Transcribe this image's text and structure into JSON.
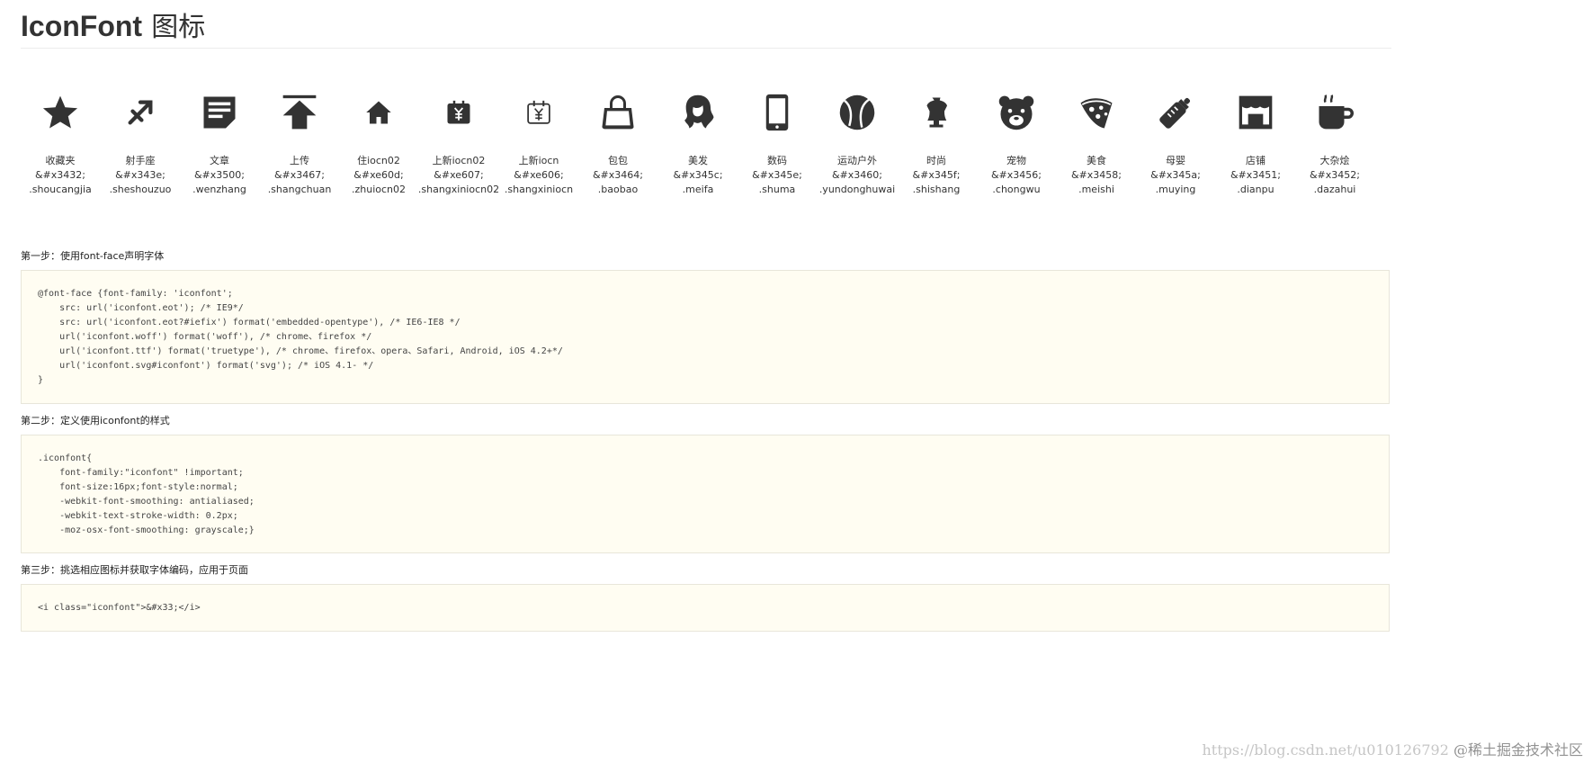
{
  "header": {
    "title_en": "IconFont",
    "title_zh": "图标"
  },
  "icons": [
    {
      "icon": "star-icon",
      "name": "收藏夹",
      "code": "&#x3432;",
      "cls": ".shoucangjia"
    },
    {
      "icon": "sagittarius-icon",
      "name": "射手座",
      "code": "&#x343e;",
      "cls": ".sheshouzuo"
    },
    {
      "icon": "article-icon",
      "name": "文章",
      "code": "&#x3500;",
      "cls": ".wenzhang"
    },
    {
      "icon": "upload-icon",
      "name": "上传",
      "code": "&#x3467;",
      "cls": ".shangchuan"
    },
    {
      "icon": "home-icon",
      "name": "住iocn02",
      "code": "&#xe60d;",
      "cls": ".zhuiocn02"
    },
    {
      "icon": "yen-calendar-icon",
      "name": "上新iocn02",
      "code": "&#xe607;",
      "cls": ".shangxiniocn02"
    },
    {
      "icon": "yen-calendar-outline-icon",
      "name": "上新iocn",
      "code": "&#xe606;",
      "cls": ".shangxiniocn"
    },
    {
      "icon": "handbag-icon",
      "name": "包包",
      "code": "&#x3464;",
      "cls": ".baobao"
    },
    {
      "icon": "hair-icon",
      "name": "美发",
      "code": "&#x345c;",
      "cls": ".meifa"
    },
    {
      "icon": "phone-icon",
      "name": "数码",
      "code": "&#x345e;",
      "cls": ".shuma"
    },
    {
      "icon": "ball-icon",
      "name": "运动户外",
      "code": "&#x3460;",
      "cls": ".yundonghuwai"
    },
    {
      "icon": "mannequin-icon",
      "name": "时尚",
      "code": "&#x345f;",
      "cls": ".shishang"
    },
    {
      "icon": "bear-icon",
      "name": "宠物",
      "code": "&#x3456;",
      "cls": ".chongwu"
    },
    {
      "icon": "pizza-icon",
      "name": "美食",
      "code": "&#x3458;",
      "cls": ".meishi"
    },
    {
      "icon": "bottle-icon",
      "name": "母婴",
      "code": "&#x345a;",
      "cls": ".muying"
    },
    {
      "icon": "store-icon",
      "name": "店铺",
      "code": "&#x3451;",
      "cls": ".dianpu"
    },
    {
      "icon": "cup-icon",
      "name": "大杂烩",
      "code": "&#x3452;",
      "cls": ".dazahui"
    }
  ],
  "steps": [
    {
      "label": "第一步：使用font-face声明字体",
      "code": "@font-face {font-family: 'iconfont';\n    src: url('iconfont.eot'); /* IE9*/\n    src: url('iconfont.eot?#iefix') format('embedded-opentype'), /* IE6-IE8 */\n    url('iconfont.woff') format('woff'), /* chrome、firefox */\n    url('iconfont.ttf') format('truetype'), /* chrome、firefox、opera、Safari, Android, iOS 4.2+*/\n    url('iconfont.svg#iconfont') format('svg'); /* iOS 4.1- */\n}"
    },
    {
      "label": "第二步：定义使用iconfont的样式",
      "code": ".iconfont{\n    font-family:\"iconfont\" !important;\n    font-size:16px;font-style:normal;\n    -webkit-font-smoothing: antialiased;\n    -webkit-text-stroke-width: 0.2px;\n    -moz-osx-font-smoothing: grayscale;}"
    },
    {
      "label": "第三步：挑选相应图标并获取字体编码，应用于页面",
      "code": "<i class=\"iconfont\">&#x33;</i>"
    }
  ],
  "watermark": {
    "url": "https://blog.csdn.net/u010126792",
    "tag": "@稀土掘金技术社区"
  }
}
